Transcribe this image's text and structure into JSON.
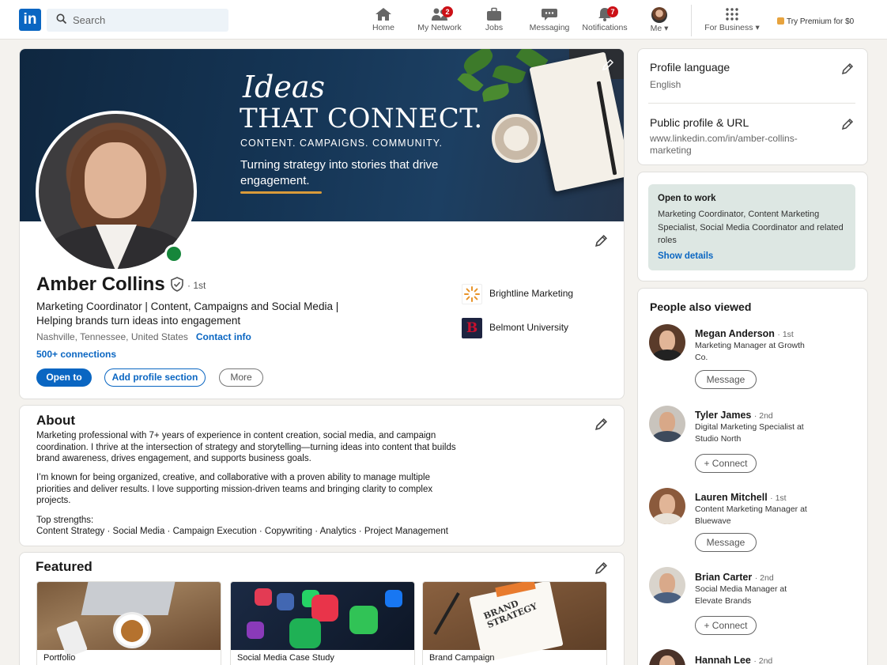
{
  "nav": {
    "search_placeholder": "Search",
    "items": [
      {
        "label": "Home"
      },
      {
        "label": "My Network",
        "badge": "2"
      },
      {
        "label": "Jobs"
      },
      {
        "label": "Messaging"
      },
      {
        "label": "Notifications",
        "badge": "7"
      },
      {
        "label": "Me"
      },
      {
        "label": "For Business"
      }
    ],
    "premium": "Try Premium for $0"
  },
  "banner": {
    "script": "Ideas",
    "headline": "THAT CONNECT.",
    "sub": "CONTENT. CAMPAIGNS. COMMUNITY.",
    "tagline": "Turning strategy into stories that drive engagement."
  },
  "profile": {
    "name": "Amber Collins",
    "degree": "· 1st",
    "headline": "Marketing Coordinator | Content, Campaigns and Social Media | Helping brands turn ideas into engagement",
    "location": "Nashville, Tennessee, United States",
    "contact": "Contact info",
    "connections": "500+ connections",
    "buttons": {
      "open_to": "Open to",
      "add_section": "Add profile section",
      "more": "More"
    },
    "orgs": [
      {
        "name": "Brightline Marketing"
      },
      {
        "name": "Belmont University",
        "logo_letter": "B"
      }
    ]
  },
  "about": {
    "title": "About",
    "p1": "Marketing professional with 7+ years of experience in content creation, social media, and campaign coordination. I thrive at the intersection of strategy and storytelling—turning ideas into content that builds brand awareness, drives engagement, and supports business goals.",
    "p2": "I’m known for being organized, creative, and collaborative with a proven ability to manage multiple priorities and deliver results. I love supporting mission-driven teams and bringing clarity to complex projects.",
    "strengths_label": "Top strengths:",
    "strengths": "Content Strategy · Social Media · Campaign Execution · Copywriting · Analytics · Project Management"
  },
  "featured": {
    "title": "Featured",
    "items": [
      {
        "caption": "Portfolio"
      },
      {
        "caption": "Social Media Case Study"
      },
      {
        "caption": "Brand Campaign",
        "img_text": "BRAND STRATEGY"
      }
    ]
  },
  "sidebar": {
    "language": {
      "title": "Profile language",
      "value": "English"
    },
    "url": {
      "title": "Public profile & URL",
      "value": "www.linkedin.com/in/amber-collins-marketing"
    },
    "open_to_work": {
      "title": "Open to work",
      "roles": "Marketing Coordinator, Content Marketing Specialist, Social Media Coordinator and related roles",
      "link": "Show details"
    },
    "people_title": "People also viewed",
    "people": [
      {
        "name": "Megan Anderson",
        "degree": "· 1st",
        "title": "Marketing Manager at Growth Co.",
        "action": "Message"
      },
      {
        "name": "Tyler James",
        "degree": "· 2nd",
        "title": "Digital Marketing Specialist at Studio North",
        "action": "+ Connect"
      },
      {
        "name": "Lauren Mitchell",
        "degree": "· 1st",
        "title": "Content Marketing Manager at Bluewave",
        "action": "Message"
      },
      {
        "name": "Brian Carter",
        "degree": "· 2nd",
        "title": "Social Media Manager at Elevate Brands",
        "action": "+ Connect"
      },
      {
        "name": "Hannah Lee",
        "degree": "· 2nd",
        "title": "",
        "action": ""
      }
    ]
  },
  "colors": {
    "brand": "#0a66c2",
    "online": "#16863b",
    "badge": "#cc1016",
    "open_to_work_bg": "#dde7e3"
  }
}
